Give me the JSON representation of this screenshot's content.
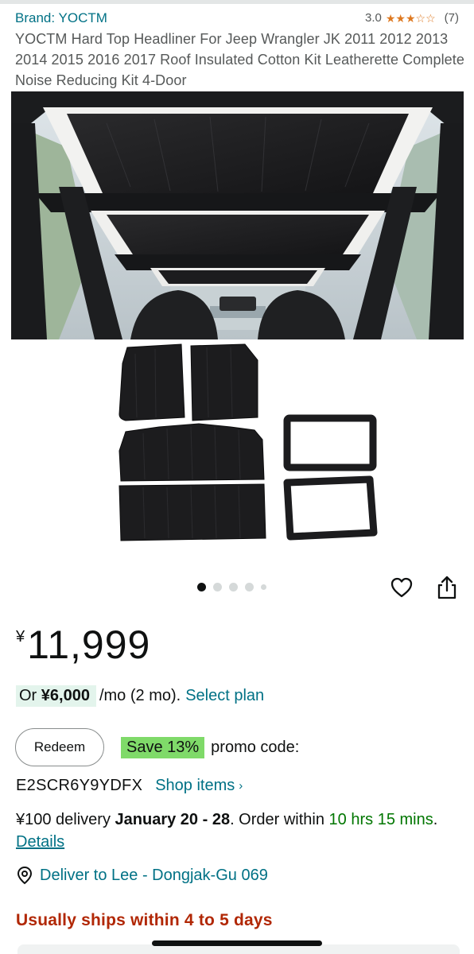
{
  "product": {
    "brand": "Brand: YOCTM",
    "rating_value": "3.0",
    "rating_stars": 3,
    "rating_count": "(7)",
    "title": "YOCTM Hard Top Headliner For Jeep Wrangler JK 2011 2012 2013 2014 2015 2016 2017 Roof Insulated Cotton Kit Leatherette Complete Noise Reducing Kit 4-Door"
  },
  "gallery": {
    "image_count": 5,
    "active_index": 0
  },
  "price": {
    "currency": "¥",
    "amount": "11,999"
  },
  "installment": {
    "or_label": "Or ",
    "amount": "¥6,000",
    "terms": "/mo (2 mo).",
    "select_plan": "Select plan"
  },
  "promo": {
    "redeem_label": "Redeem",
    "save_label": "Save 13%",
    "promo_label": "promo code:",
    "code": "E2SCR6Y9YDFX",
    "shop_items": "Shop items"
  },
  "delivery": {
    "fee": "¥100 delivery ",
    "dates": "January 20 - 28",
    "order_within": ". Order within ",
    "countdown": "10 hrs 15 mins",
    "period": ". ",
    "details": "Details"
  },
  "location": {
    "deliver_to": "Deliver to Lee - Dongjak-Gu 069"
  },
  "availability": {
    "ships": "Usually ships within 4 to 5 days"
  },
  "colors": {
    "link": "#007185",
    "star": "#de7921",
    "save_badge": "#7fda69",
    "installment_bg": "#e3f4ec",
    "availability": "#b12704",
    "countdown": "#007600"
  }
}
